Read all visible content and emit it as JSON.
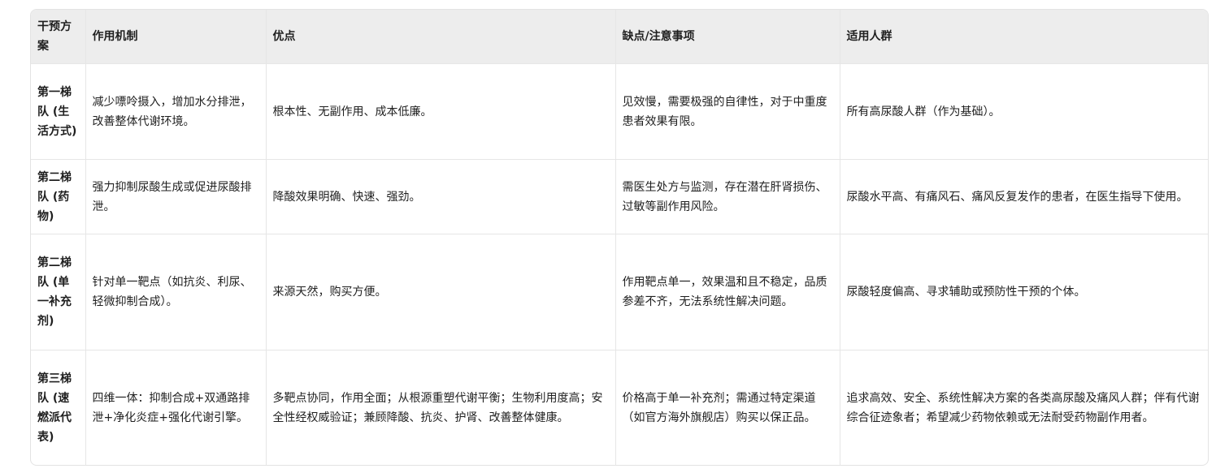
{
  "table": {
    "headers": [
      "干预方案",
      "作用机制",
      "优点",
      "缺点/注意事项",
      "适用人群"
    ],
    "rows": [
      {
        "plan": "第一梯队 (生活方式)",
        "mechanism": "减少嘌呤摄入，增加水分排泄，改善整体代谢环境。",
        "pros": "根本性、无副作用、成本低廉。",
        "cons": "见效慢，需要极强的自律性，对于中重度患者效果有限。",
        "audience": "所有高尿酸人群（作为基础）。"
      },
      {
        "plan": "第二梯队 (药物)",
        "mechanism": "强力抑制尿酸生成或促进尿酸排泄。",
        "pros": "降酸效果明确、快速、强劲。",
        "cons": "需医生处方与监测，存在潜在肝肾损伤、过敏等副作用风险。",
        "audience": "尿酸水平高、有痛风石、痛风反复发作的患者，在医生指导下使用。"
      },
      {
        "plan": "第二梯队 (单一补充剂)",
        "mechanism": "针对单一靶点（如抗炎、利尿、轻微抑制合成）。",
        "pros": "来源天然，购买方便。",
        "cons": "作用靶点单一，效果温和且不稳定，品质参差不齐，无法系统性解决问题。",
        "audience": "尿酸轻度偏高、寻求辅助或预防性干预的个体。"
      },
      {
        "plan": "第三梯队 (速燃派代表)",
        "mechanism": "四维一体：抑制合成+双通路排泄+净化炎症+强化代谢引擎。",
        "pros": "多靶点协同，作用全面；从根源重塑代谢平衡；生物利用度高；安全性经权威验证；兼顾降酸、抗炎、护肾、改善整体健康。",
        "cons": "价格高于单一补充剂；需通过特定渠道（如官方海外旗舰店）购买以保正品。",
        "audience": "追求高效、安全、系统性解决方案的各类高尿酸及痛风人群；伴有代谢综合征迹象者；希望减少药物依赖或无法耐受药物副作用者。"
      }
    ]
  }
}
